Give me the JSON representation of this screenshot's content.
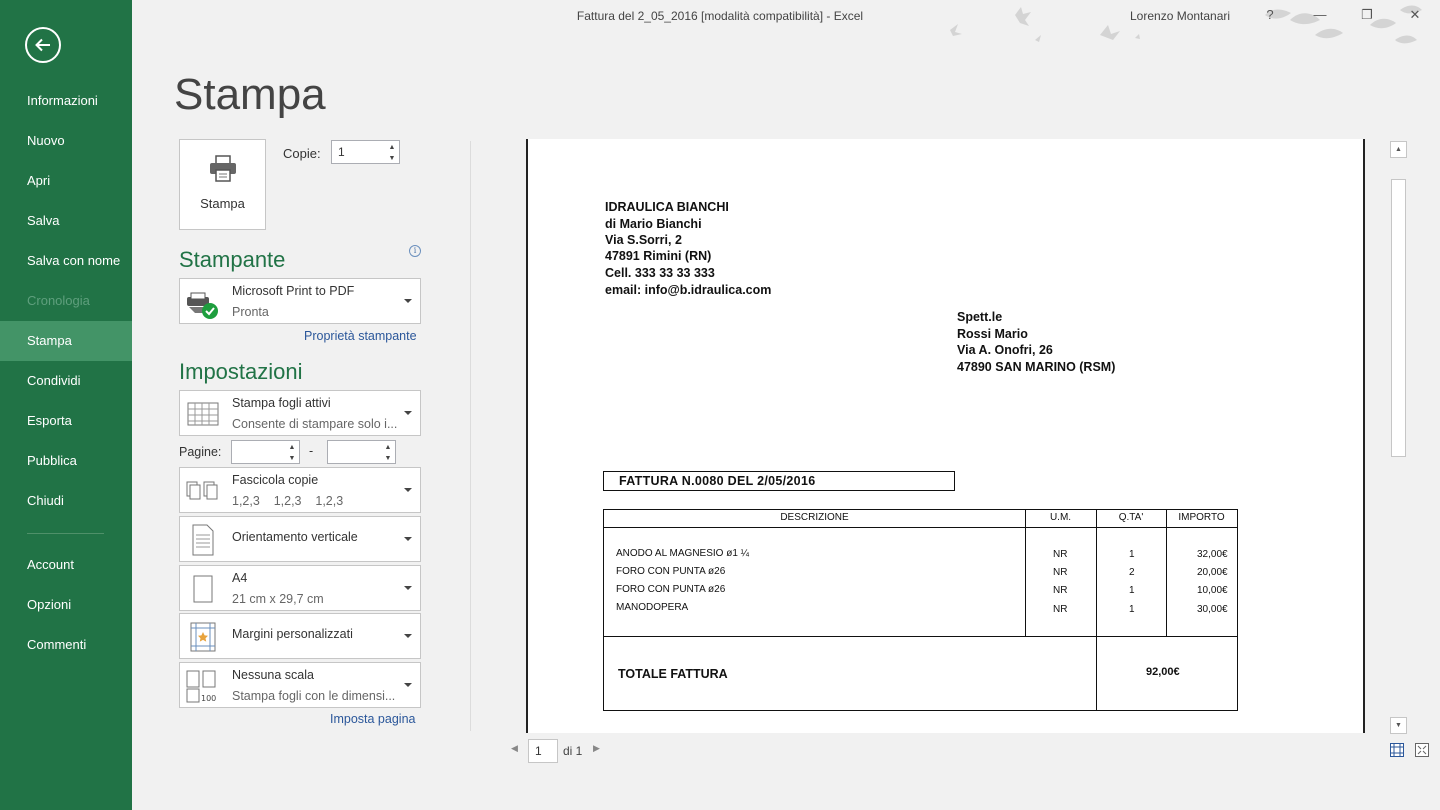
{
  "window": {
    "title": "Fattura del 2_05_2016  [modalità compatibilità] - Excel",
    "user": "Lorenzo Montanari",
    "help": "?",
    "minimize": "—",
    "restore": "❐",
    "close": "✕"
  },
  "sidebar": {
    "items": [
      {
        "label": "Informazioni"
      },
      {
        "label": "Nuovo"
      },
      {
        "label": "Apri"
      },
      {
        "label": "Salva"
      },
      {
        "label": "Salva con nome"
      },
      {
        "label": "Cronologia"
      },
      {
        "label": "Stampa"
      },
      {
        "label": "Condividi"
      },
      {
        "label": "Esporta"
      },
      {
        "label": "Pubblica"
      },
      {
        "label": "Chiudi"
      },
      {
        "label": "Account"
      },
      {
        "label": "Opzioni"
      },
      {
        "label": "Commenti"
      }
    ],
    "accent": "#217346"
  },
  "print": {
    "title": "Stampa",
    "button_label": "Stampa",
    "copies_label": "Copie:",
    "copies_value": "1"
  },
  "printer": {
    "section_title": "Stampante",
    "info": "i",
    "name": "Microsoft Print to PDF",
    "status": "Pronta",
    "properties_link": "Proprietà stampante"
  },
  "settings": {
    "section_title": "Impostazioni",
    "scope": {
      "title": "Stampa fogli attivi",
      "subtitle": "Consente di stampare solo i..."
    },
    "pages_label": "Pagine:",
    "pages_from": "",
    "pages_dash": "-",
    "pages_to": "",
    "collate": {
      "title": "Fascicola copie",
      "subtitle": "1,2,3    1,2,3    1,2,3"
    },
    "orientation": {
      "title": "Orientamento verticale"
    },
    "paper": {
      "title": "A4",
      "subtitle": "21 cm x 29,7 cm"
    },
    "margins": {
      "title": "Margini personalizzati"
    },
    "scaling": {
      "title": "Nessuna scala",
      "subtitle": "Stampa fogli con le dimensi..."
    },
    "page_setup_link": "Imposta pagina"
  },
  "document": {
    "sender": [
      "IDRAULICA BIANCHI",
      "di Mario Bianchi",
      "Via S.Sorri, 2",
      "47891 Rimini (RN)",
      "Cell. 333 33 33 333",
      "email: info@b.idraulica.com"
    ],
    "recipient": [
      "Spett.le",
      "Rossi Mario",
      "Via A. Onofri, 26",
      "47890 SAN MARINO (RSM)"
    ],
    "invoice_title": "FATTURA N.0080 DEL 2/05/2016",
    "table": {
      "headers": [
        "DESCRIZIONE",
        "U.M.",
        "Q.TA'",
        "IMPORTO"
      ],
      "rows": [
        {
          "desc": "ANODO AL MAGNESIO  ø1 ¼",
          "um": "NR",
          "qty": "1",
          "amount": "32,00€"
        },
        {
          "desc": "FORO CON PUNTA  ø26",
          "um": "NR",
          "qty": "2",
          "amount": "20,00€"
        },
        {
          "desc": "FORO CON PUNTA  ø26",
          "um": "NR",
          "qty": "1",
          "amount": "10,00€"
        },
        {
          "desc": "MANODOPERA",
          "um": "NR",
          "qty": "1",
          "amount": "30,00€"
        }
      ],
      "total_label": "TOTALE FATTURA",
      "total_value": "92,00€"
    }
  },
  "page_nav": {
    "prev": "◀",
    "current": "1",
    "of": "di 1",
    "next": "▶"
  }
}
